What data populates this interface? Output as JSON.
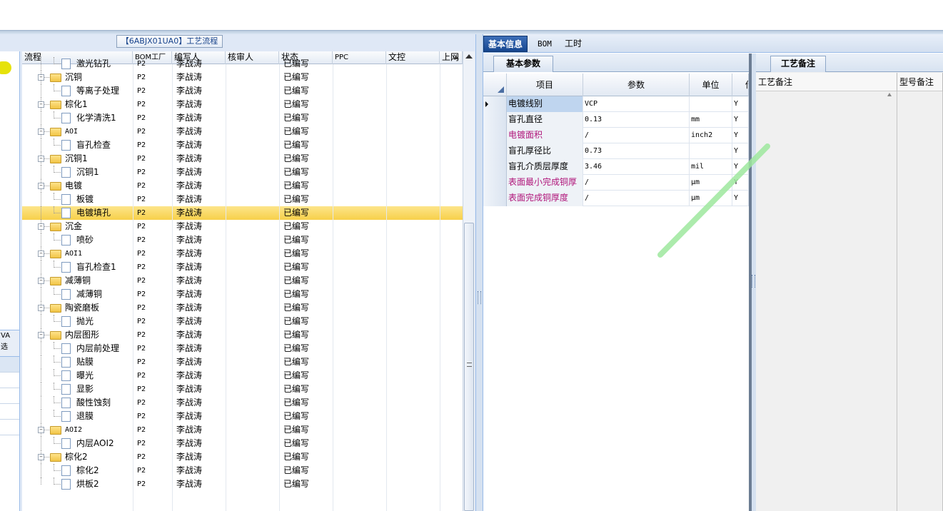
{
  "left_panel": {
    "title": "【6ABJX01UA0】工艺流程",
    "far_left_header": "VA\n选"
  },
  "tree": {
    "columns": [
      "流程",
      "BOM工厂",
      "编写人",
      "核审人",
      "状态",
      "PPC",
      "文控",
      "上网"
    ],
    "rows": [
      {
        "name": "激光钻孔",
        "level": 1,
        "type": "doc",
        "bom": "P2",
        "writer": "李战涛",
        "status": "已编写",
        "partial": true
      },
      {
        "name": "沉铜",
        "level": 0,
        "type": "folder",
        "bom": "P2",
        "writer": "李战涛",
        "status": "已编写"
      },
      {
        "name": "等离子处理",
        "level": 1,
        "type": "doc",
        "bom": "P2",
        "writer": "李战涛",
        "status": "已编写"
      },
      {
        "name": "棕化1",
        "level": 0,
        "type": "folder",
        "bom": "P2",
        "writer": "李战涛",
        "status": "已编写"
      },
      {
        "name": "化学清洗1",
        "level": 1,
        "type": "doc",
        "bom": "P2",
        "writer": "李战涛",
        "status": "已编写"
      },
      {
        "name": "AOI",
        "level": 0,
        "type": "folder",
        "bom": "P2",
        "writer": "李战涛",
        "status": "已编写"
      },
      {
        "name": "盲孔检查",
        "level": 1,
        "type": "doc",
        "bom": "P2",
        "writer": "李战涛",
        "status": "已编写"
      },
      {
        "name": "沉铜1",
        "level": 0,
        "type": "folder",
        "bom": "P2",
        "writer": "李战涛",
        "status": "已编写"
      },
      {
        "name": "沉铜1",
        "level": 1,
        "type": "doc",
        "bom": "P2",
        "writer": "李战涛",
        "status": "已编写"
      },
      {
        "name": "电镀",
        "level": 0,
        "type": "folder",
        "bom": "P2",
        "writer": "李战涛",
        "status": "已编写"
      },
      {
        "name": "板镀",
        "level": 1,
        "type": "doc",
        "bom": "P2",
        "writer": "李战涛",
        "status": "已编写"
      },
      {
        "name": "电镀填孔",
        "level": 1,
        "type": "doc",
        "bom": "P2",
        "writer": "李战涛",
        "status": "已编写",
        "selected": true
      },
      {
        "name": "沉金",
        "level": 0,
        "type": "folder",
        "bom": "P2",
        "writer": "李战涛",
        "status": "已编写"
      },
      {
        "name": "喷砂",
        "level": 1,
        "type": "doc",
        "bom": "P2",
        "writer": "李战涛",
        "status": "已编写"
      },
      {
        "name": "AOI1",
        "level": 0,
        "type": "folder",
        "bom": "P2",
        "writer": "李战涛",
        "status": "已编写"
      },
      {
        "name": "盲孔检查1",
        "level": 1,
        "type": "doc",
        "bom": "P2",
        "writer": "李战涛",
        "status": "已编写"
      },
      {
        "name": "减薄铜",
        "level": 0,
        "type": "folder",
        "bom": "P2",
        "writer": "李战涛",
        "status": "已编写"
      },
      {
        "name": "减薄铜",
        "level": 1,
        "type": "doc",
        "bom": "P2",
        "writer": "李战涛",
        "status": "已编写"
      },
      {
        "name": "陶瓷磨板",
        "level": 0,
        "type": "folder",
        "bom": "P2",
        "writer": "李战涛",
        "status": "已编写"
      },
      {
        "name": "抛光",
        "level": 1,
        "type": "doc",
        "bom": "P2",
        "writer": "李战涛",
        "status": "已编写"
      },
      {
        "name": "内层图形",
        "level": 0,
        "type": "folder",
        "bom": "P2",
        "writer": "李战涛",
        "status": "已编写"
      },
      {
        "name": "内层前处理",
        "level": 1,
        "type": "doc",
        "bom": "P2",
        "writer": "李战涛",
        "status": "已编写"
      },
      {
        "name": "贴膜",
        "level": 1,
        "type": "doc",
        "bom": "P2",
        "writer": "李战涛",
        "status": "已编写"
      },
      {
        "name": "曝光",
        "level": 1,
        "type": "doc",
        "bom": "P2",
        "writer": "李战涛",
        "status": "已编写"
      },
      {
        "name": "显影",
        "level": 1,
        "type": "doc",
        "bom": "P2",
        "writer": "李战涛",
        "status": "已编写"
      },
      {
        "name": "酸性蚀刻",
        "level": 1,
        "type": "doc",
        "bom": "P2",
        "writer": "李战涛",
        "status": "已编写"
      },
      {
        "name": "退膜",
        "level": 1,
        "type": "doc",
        "bom": "P2",
        "writer": "李战涛",
        "status": "已编写"
      },
      {
        "name": "AOI2",
        "level": 0,
        "type": "folder",
        "bom": "P2",
        "writer": "李战涛",
        "status": "已编写"
      },
      {
        "name": "内层AOI2",
        "level": 1,
        "type": "doc",
        "bom": "P2",
        "writer": "李战涛",
        "status": "已编写"
      },
      {
        "name": "棕化2",
        "level": 0,
        "type": "folder",
        "bom": "P2",
        "writer": "李战涛",
        "status": "已编写"
      },
      {
        "name": "棕化2",
        "level": 1,
        "type": "doc",
        "bom": "P2",
        "writer": "李战涛",
        "status": "已编写"
      },
      {
        "name": "烘板2",
        "level": 1,
        "type": "doc",
        "bom": "P2",
        "writer": "李战涛",
        "status": "已编写",
        "last": true
      }
    ]
  },
  "main_tabs": [
    {
      "label": "基本信息",
      "active": true
    },
    {
      "label": "BOM",
      "active": false
    },
    {
      "label": "工时",
      "active": false
    }
  ],
  "basic_params": {
    "tab_label": "基本参数",
    "columns": [
      "项目",
      "参数",
      "单位",
      "传"
    ],
    "rows": [
      {
        "item": "电镀线别",
        "param": "VCP",
        "unit": "",
        "flag": "Y",
        "highlight": true,
        "current": true
      },
      {
        "item": "盲孔直径",
        "param": "0.13",
        "unit": "mm",
        "flag": "Y"
      },
      {
        "item": "电镀面积",
        "param": "/",
        "unit": "inch2",
        "flag": "Y",
        "pink": true
      },
      {
        "item": "盲孔厚径比",
        "param": "0.73",
        "unit": "",
        "flag": "Y"
      },
      {
        "item": "盲孔介质层厚度",
        "param": "3.46",
        "unit": "mil",
        "flag": "Y"
      },
      {
        "item": "表面最小完成铜厚",
        "param": "/",
        "unit": "μm",
        "flag": "Y",
        "pink": true
      },
      {
        "item": "表面完成铜厚度",
        "param": "/",
        "unit": "μm",
        "flag": "Y",
        "pink": true
      }
    ]
  },
  "notes": {
    "tab_label": "工艺备注",
    "columns": [
      "工艺备注",
      "型号备注"
    ]
  },
  "colors": {
    "selected_row": "#f7d04a",
    "active_tab": "#16468f",
    "pink_text": "#b0157a",
    "highlight_cell": "#bfd5ef",
    "green_stroke": "#9ee89e"
  }
}
